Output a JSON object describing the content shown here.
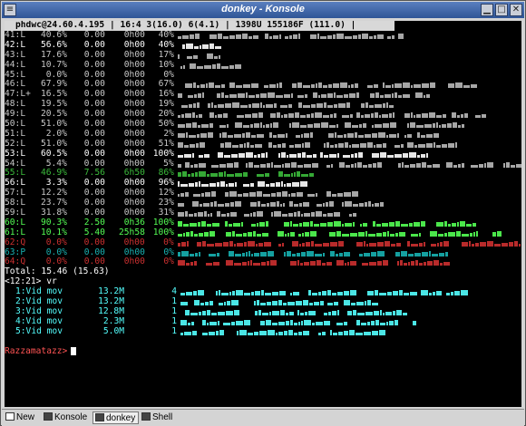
{
  "window": {
    "title": "donkey - Konsole"
  },
  "titlebar": {
    "menu_glyph": "≡",
    "minimize_glyph": "▁",
    "maximize_glyph": "□",
    "close_glyph": "✕"
  },
  "terminal": {
    "status_line": "phdwc@24.60.4.195 | 16:4 3(16.0) 6(4.1) | 1398U 155186F (111.0) |",
    "queue_rows": [
      {
        "id": "41:L",
        "flag": " ",
        "pct": "40.6%",
        "rate": "0.00",
        "time": "0h00",
        "done": "40%",
        "color": "g"
      },
      {
        "id": "42:L",
        "flag": " ",
        "pct": "56.6%",
        "rate": "0.00",
        "time": "0h00",
        "done": "40%",
        "color": "w"
      },
      {
        "id": "43:L",
        "flag": " ",
        "pct": "17.6%",
        "rate": "0.00",
        "time": "0h00",
        "done": "17%",
        "color": "g"
      },
      {
        "id": "44:L",
        "flag": " ",
        "pct": "10.7%",
        "rate": "0.00",
        "time": "0h00",
        "done": "10%",
        "color": "g"
      },
      {
        "id": "45:L",
        "flag": " ",
        "pct": "0.0%",
        "rate": "0.00",
        "time": "0h00",
        "done": "0%",
        "color": "g"
      },
      {
        "id": "46:L",
        "flag": " ",
        "pct": "67.9%",
        "rate": "0.00",
        "time": "0h00",
        "done": "67%",
        "color": "g"
      },
      {
        "id": "47:L",
        "flag": "+",
        "pct": "16.5%",
        "rate": "0.00",
        "time": "0h00",
        "done": "16%",
        "color": "g"
      },
      {
        "id": "48:L",
        "flag": " ",
        "pct": "19.5%",
        "rate": "0.00",
        "time": "0h00",
        "done": "19%",
        "color": "g"
      },
      {
        "id": "49:L",
        "flag": " ",
        "pct": "20.5%",
        "rate": "0.00",
        "time": "0h00",
        "done": "20%",
        "color": "g"
      },
      {
        "id": "50:L",
        "flag": " ",
        "pct": "51.0%",
        "rate": "0.00",
        "time": "0h00",
        "done": "50%",
        "color": "g"
      },
      {
        "id": "51:L",
        "flag": " ",
        "pct": "2.0%",
        "rate": "0.00",
        "time": "0h00",
        "done": "2%",
        "color": "g"
      },
      {
        "id": "52:L",
        "flag": " ",
        "pct": "51.0%",
        "rate": "0.00",
        "time": "0h00",
        "done": "51%",
        "color": "g"
      },
      {
        "id": "53:L",
        "flag": " ",
        "pct": "60.5%",
        "rate": "0.00",
        "time": "0h00",
        "done": "100%",
        "color": "w"
      },
      {
        "id": "54:L",
        "flag": " ",
        "pct": "5.4%",
        "rate": "0.00",
        "time": "0h00",
        "done": "5%",
        "color": "g"
      },
      {
        "id": "55:L",
        "flag": " ",
        "pct": "46.9%",
        "rate": "7.56",
        "time": "6h50",
        "done": "86%",
        "color": "dgr"
      },
      {
        "id": "56:L",
        "flag": " ",
        "pct": "3.3%",
        "rate": "0.00",
        "time": "0h00",
        "done": "96%",
        "color": "w"
      },
      {
        "id": "57:L",
        "flag": " ",
        "pct": "12.2%",
        "rate": "0.00",
        "time": "0h00",
        "done": "12%",
        "color": "g"
      },
      {
        "id": "58:L",
        "flag": " ",
        "pct": "23.7%",
        "rate": "0.00",
        "time": "0h00",
        "done": "23%",
        "color": "g"
      },
      {
        "id": "59:L",
        "flag": " ",
        "pct": "31.8%",
        "rate": "0.00",
        "time": "0h00",
        "done": "31%",
        "color": "g"
      },
      {
        "id": "60:L",
        "flag": " ",
        "pct": "90.3%",
        "rate": "2.50",
        "time": "0h36",
        "done": "100%",
        "color": "lg"
      },
      {
        "id": "61:L",
        "flag": " ",
        "pct": "10.1%",
        "rate": "5.40",
        "time": "25h58",
        "done": "100%",
        "color": "lg"
      },
      {
        "id": "62:Q",
        "flag": " ",
        "pct": "0.0%",
        "rate": "0.00",
        "time": "0h00",
        "done": "0%",
        "color": "dr"
      },
      {
        "id": "63:P",
        "flag": " ",
        "pct": "0.0%",
        "rate": "0.00",
        "time": "0h00",
        "done": "0%",
        "color": "dc"
      },
      {
        "id": "64:Q",
        "flag": " ",
        "pct": "0.0%",
        "rate": "0.00",
        "time": "0h00",
        "done": "0%",
        "color": "dr"
      }
    ],
    "total_line": "Total: 15.46 (15.63)",
    "command_line": "<12:21> vr",
    "results": [
      {
        "index": "1:Vid mov",
        "size": "13.2M",
        "count": "4"
      },
      {
        "index": "2:Vid mov",
        "size": "13.2M",
        "count": "1"
      },
      {
        "index": "3:Vid mov",
        "size": "12.8M",
        "count": "1"
      },
      {
        "index": "4:Vid mov",
        "size": "2.3M",
        "count": "1"
      },
      {
        "index": "5:Vid mov",
        "size": "5.0M",
        "count": "1"
      }
    ],
    "prompt": "Razzamatazz>"
  },
  "tabs": [
    {
      "label": "New",
      "icon": "new-session-icon"
    },
    {
      "label": "Konsole",
      "icon": "terminal-icon"
    },
    {
      "label": "donkey",
      "icon": "terminal-icon",
      "active": true
    },
    {
      "label": "Shell",
      "icon": "terminal-icon"
    }
  ],
  "colors": {
    "titlebar": "#2f5596",
    "terminal_bg": "#000000",
    "prompt": "#ff5454",
    "results": "#54ffff"
  }
}
